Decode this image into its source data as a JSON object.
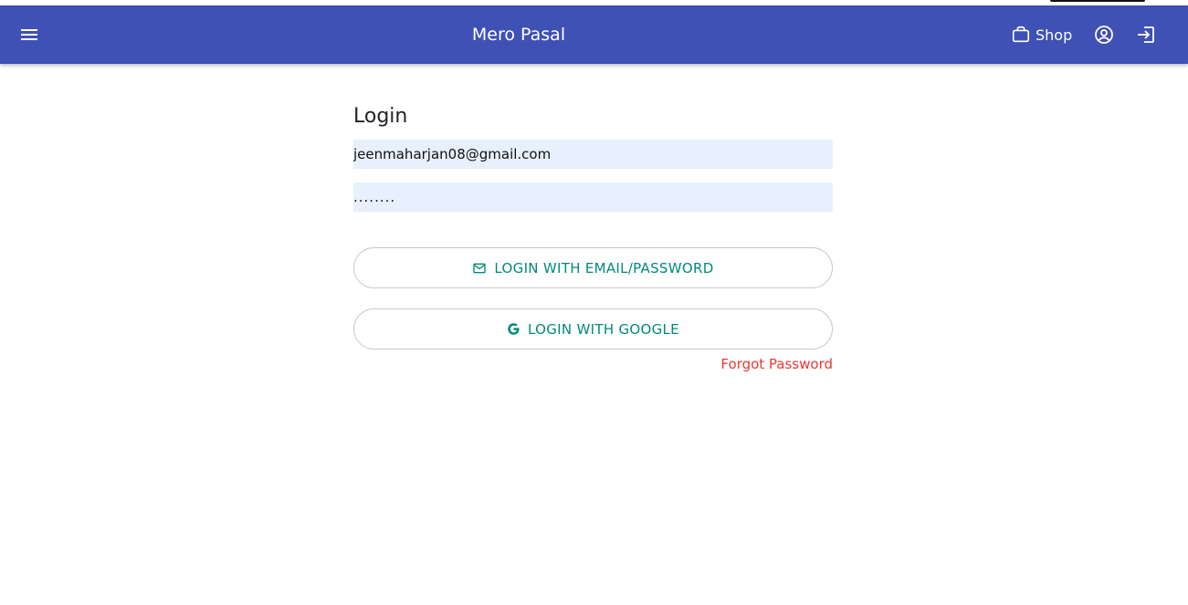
{
  "header": {
    "title": "Mero Pasal",
    "shop_label": "Shop",
    "background": "#3f51b5"
  },
  "icons": {
    "menu": "hamburger-icon",
    "shop": "briefcase-icon",
    "account": "account-circle-icon",
    "logout": "logout-icon",
    "email": "mail-icon",
    "google": "google-icon"
  },
  "login": {
    "heading": "Login",
    "email_value": "jeenmaharjan08@gmail.com",
    "password_value": "........",
    "email_button": "LOGIN WITH EMAIL/PASSWORD",
    "google_button": "LOGIN WITH GOOGLE",
    "forgot_password": "Forgot Password"
  },
  "colors": {
    "accent": "#00897b",
    "danger": "#e53935",
    "input_bg": "#e8f0fe"
  }
}
